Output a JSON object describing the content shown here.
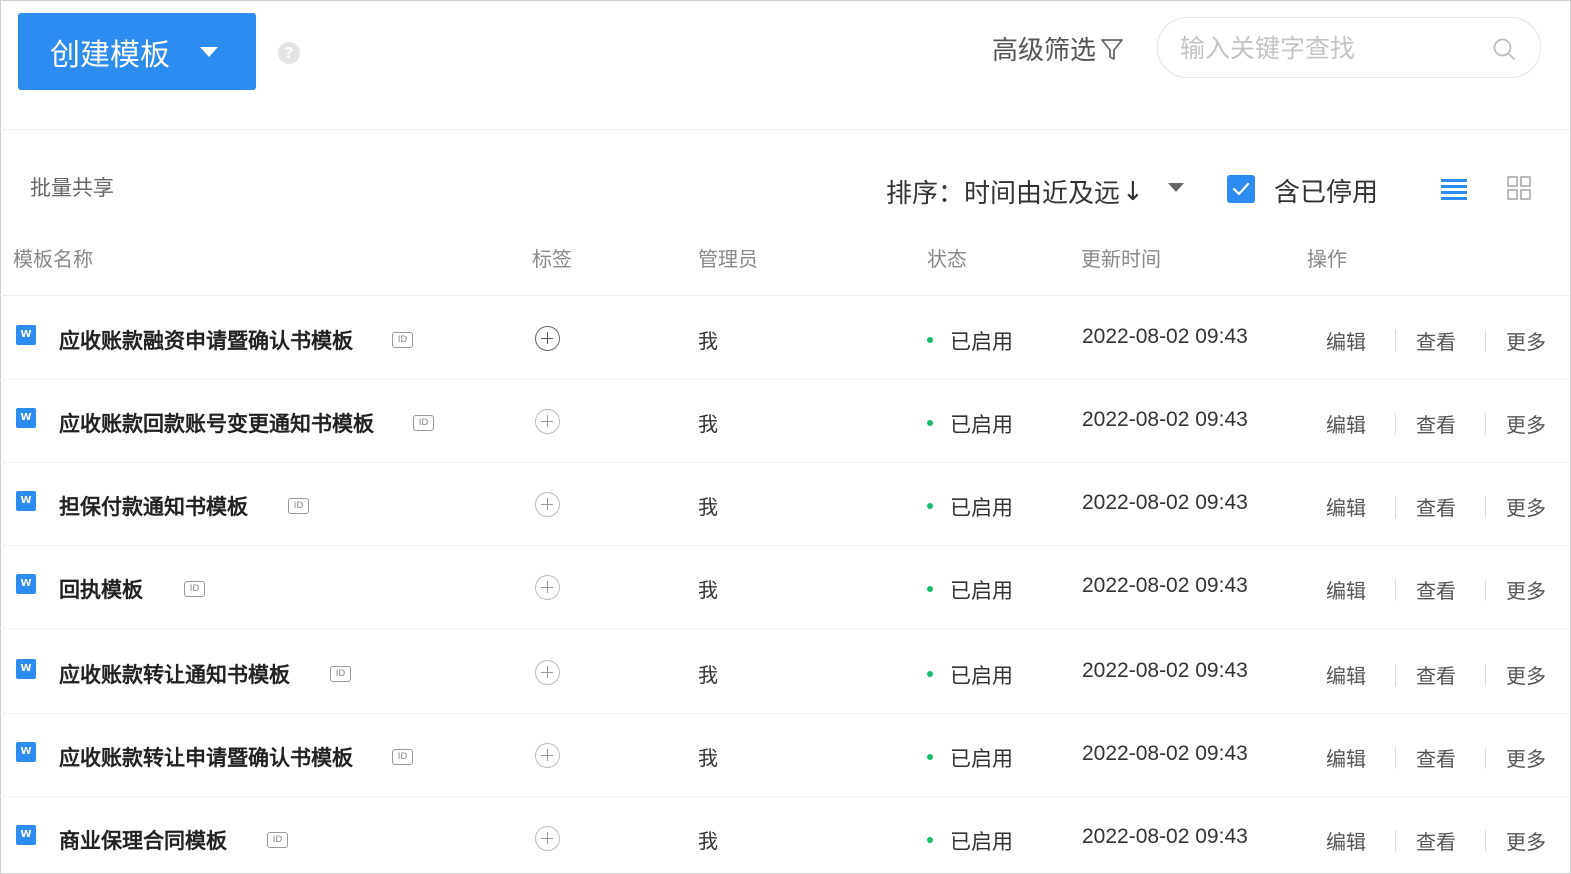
{
  "header": {
    "create_label": "创建模板",
    "help_glyph": "?",
    "advanced_filter_label": "高级筛选",
    "search_placeholder": "输入关键字查找"
  },
  "toolbar": {
    "batch_share_label": "批量共享",
    "sort_label": "排序：时间由近及远",
    "sort_arrow": "↓",
    "include_disabled_label": "含已停用",
    "include_disabled_checked": true
  },
  "columns": {
    "name": "模板名称",
    "tags": "标签",
    "admin": "管理员",
    "status": "状态",
    "updated": "更新时间",
    "actions": "操作"
  },
  "rows": [
    {
      "name": "应收账款融资申请暨确认书模板",
      "admin": "我",
      "status": "已启用",
      "updated": "2022-08-02 09:43"
    },
    {
      "name": "应收账款回款账号变更通知书模板",
      "admin": "我",
      "status": "已启用",
      "updated": "2022-08-02 09:43"
    },
    {
      "name": "担保付款通知书模板",
      "admin": "我",
      "status": "已启用",
      "updated": "2022-08-02 09:43"
    },
    {
      "name": "回执模板",
      "admin": "我",
      "status": "已启用",
      "updated": "2022-08-02 09:43"
    },
    {
      "name": "应收账款转让通知书模板",
      "admin": "我",
      "status": "已启用",
      "updated": "2022-08-02 09:43"
    },
    {
      "name": "应收账款转让申请暨确认书模板",
      "admin": "我",
      "status": "已启用",
      "updated": "2022-08-02 09:43"
    },
    {
      "name": "商业保理合同模板",
      "admin": "我",
      "status": "已启用",
      "updated": "2022-08-02 09:43"
    }
  ],
  "row_actions": {
    "edit": "编辑",
    "view": "查看",
    "more": "更多"
  },
  "badges": {
    "doc": "W",
    "id": "ID"
  },
  "colors": {
    "primary": "#2d8cf0",
    "status_enabled": "#19be6b"
  }
}
